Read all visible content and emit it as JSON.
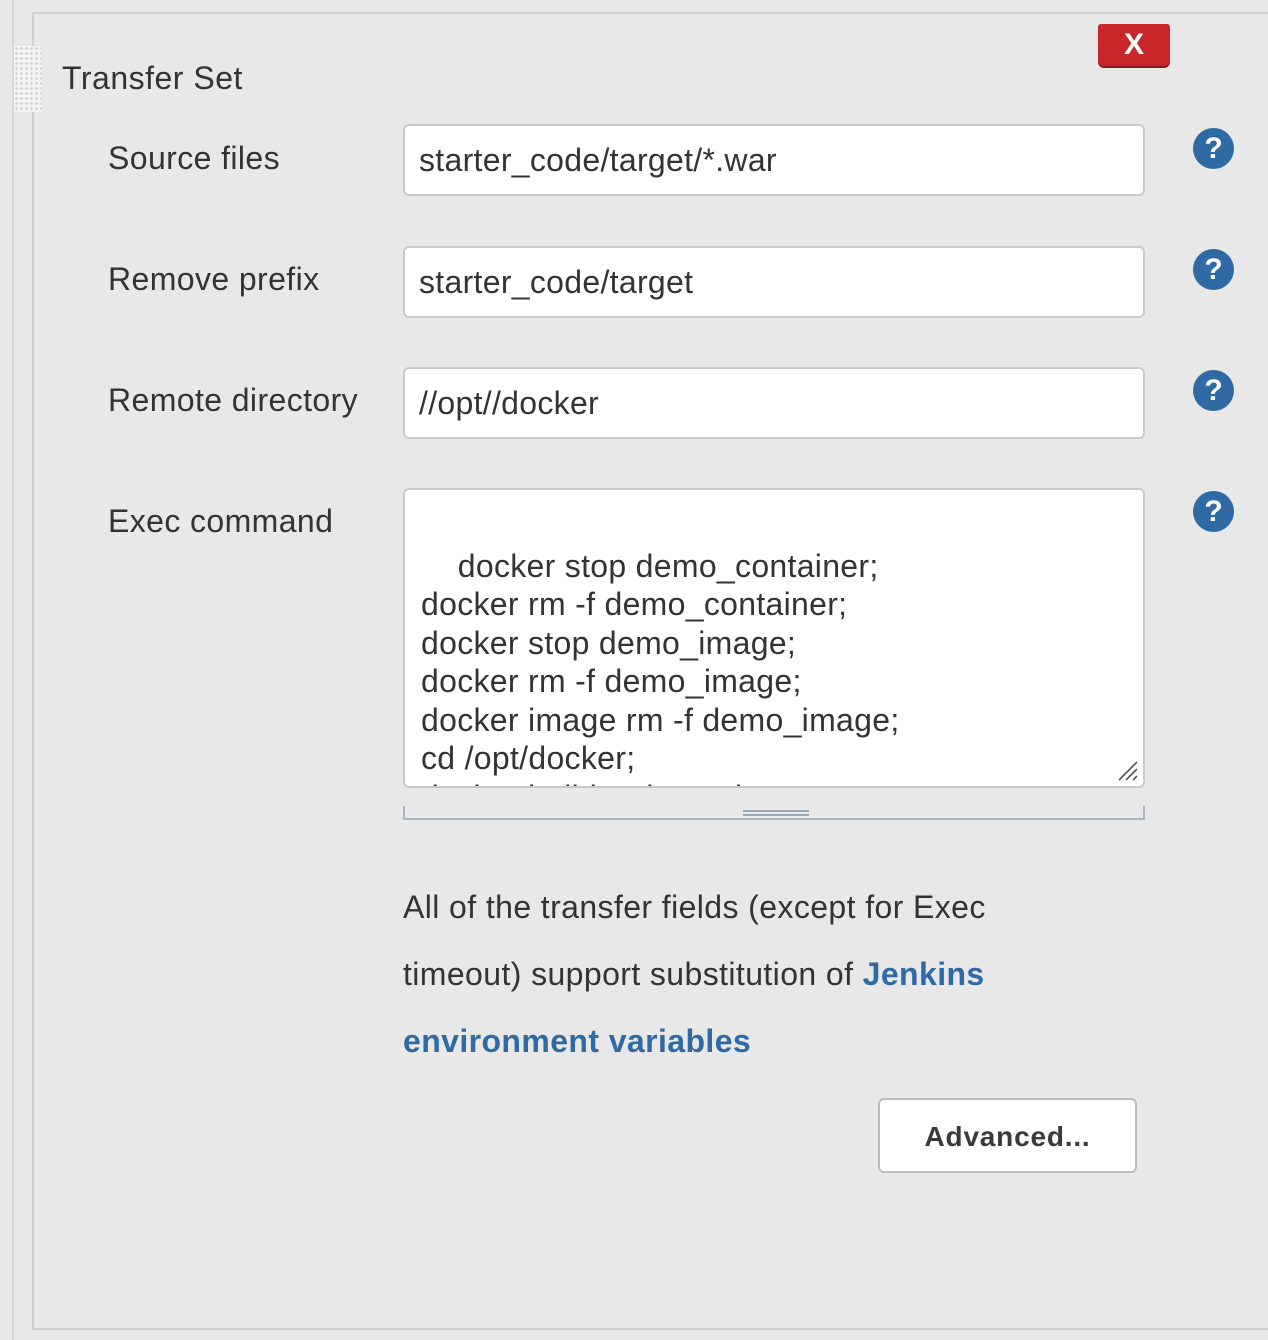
{
  "section": {
    "title": "Transfer Set",
    "close_label": "X"
  },
  "fields": {
    "source_files": {
      "label": "Source files",
      "value": "starter_code/target/*.war"
    },
    "remove_prefix": {
      "label": "Remove prefix",
      "value": "starter_code/target"
    },
    "remote_directory": {
      "label": "Remote directory",
      "value": "//opt//docker"
    },
    "exec_command": {
      "label": "Exec command",
      "value": "docker stop demo_container;\ndocker rm -f demo_container;\ndocker stop demo_image;\ndocker rm -f demo_image;\ndocker image rm -f demo_image;\ncd /opt/docker;\ndocker build -t demo_image ."
    }
  },
  "help_icon_label": "?",
  "help": {
    "text_before": "All of the transfer fields (except for Exec timeout) support substitution of ",
    "link_text": "Jenkins environment variables"
  },
  "advanced_button": "Advanced...",
  "colors": {
    "accent": "#2f6aa4",
    "danger": "#c8262b",
    "background": "#e8e8e8"
  },
  "icons": {
    "help": "question-circle-icon",
    "close": "close-icon",
    "drag": "drag-handle-icon",
    "resize": "resize-grip-icon"
  }
}
